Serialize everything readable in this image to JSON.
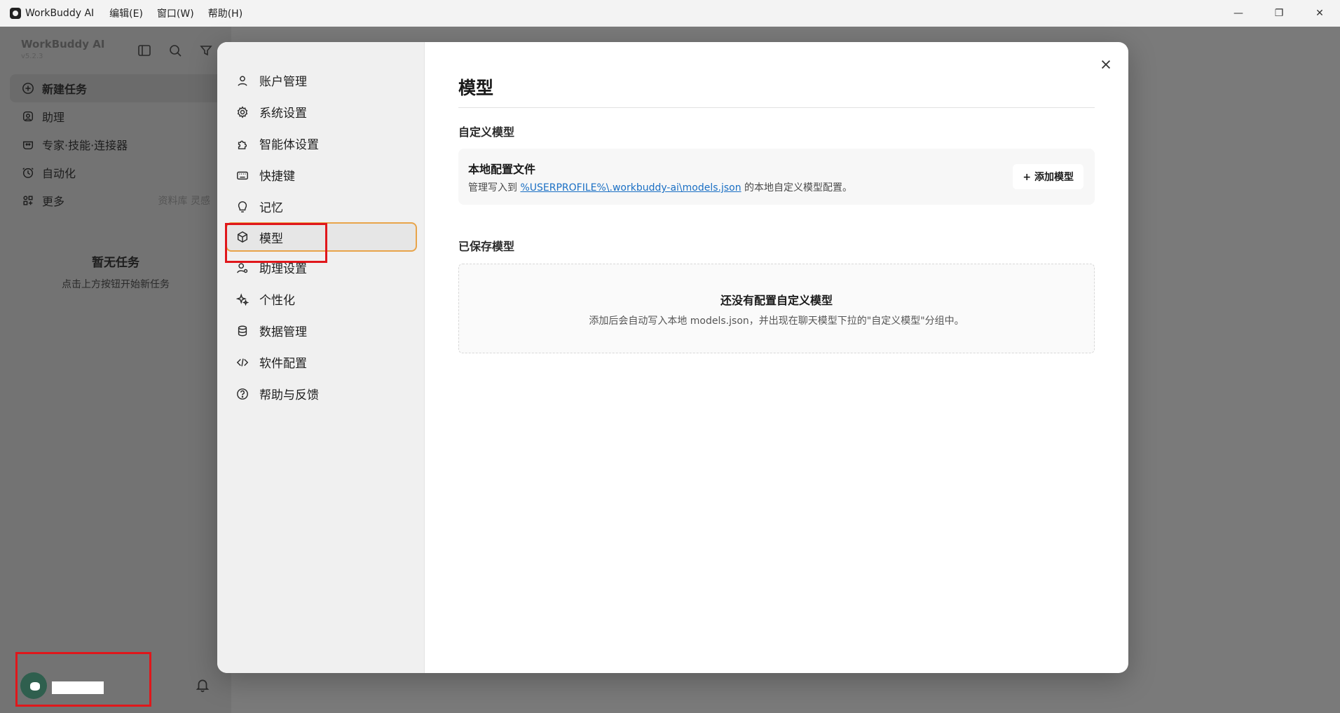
{
  "titlebar": {
    "app_name": "WorkBuddy AI",
    "menus": [
      "编辑(E)",
      "窗口(W)",
      "帮助(H)"
    ],
    "minimize": "—",
    "maximize": "❐",
    "close": "✕"
  },
  "sidebar": {
    "title": "WorkBuddy AI",
    "version": "v5.2.3",
    "items": [
      {
        "label": "新建任务",
        "icon": "plus-chat-icon"
      },
      {
        "label": "助理",
        "icon": "assistant-icon"
      },
      {
        "label": "专家·技能·连接器",
        "icon": "expert-icon"
      },
      {
        "label": "自动化",
        "icon": "clock-icon"
      },
      {
        "label": "更多",
        "icon": "grid-icon",
        "hint": "资料库 灵感"
      }
    ],
    "empty_title": "暂无任务",
    "empty_subtitle": "点击上方按钮开始新任务"
  },
  "settings_nav": {
    "items": [
      {
        "label": "账户管理",
        "icon": "user-icon"
      },
      {
        "label": "系统设置",
        "icon": "gear-icon"
      },
      {
        "label": "智能体设置",
        "icon": "puzzle-icon"
      },
      {
        "label": "快捷键",
        "icon": "keyboard-icon"
      },
      {
        "label": "记忆",
        "icon": "memory-icon"
      },
      {
        "label": "模型",
        "icon": "cube-icon"
      },
      {
        "label": "助理设置",
        "icon": "user-gear-icon"
      },
      {
        "label": "个性化",
        "icon": "sparkle-icon"
      },
      {
        "label": "数据管理",
        "icon": "database-icon"
      },
      {
        "label": "软件配置",
        "icon": "code-icon"
      },
      {
        "label": "帮助与反馈",
        "icon": "help-icon"
      }
    ],
    "active_index": 5
  },
  "main": {
    "title": "模型",
    "custom_section_label": "自定义模型",
    "local_config": {
      "title": "本地配置文件",
      "desc_prefix": "管理写入到 ",
      "desc_path": "%USERPROFILE%\\.workbuddy-ai\\models.json",
      "desc_suffix": " 的本地自定义模型配置。",
      "add_button": "+ 添加模型"
    },
    "saved_section_label": "已保存模型",
    "empty": {
      "title": "还没有配置自定义模型",
      "subtitle": "添加后会自动写入本地 models.json，并出现在聊天模型下拉的\"自定义模型\"分组中。"
    }
  },
  "colors": {
    "highlight_red": "#e0171b",
    "active_border": "#e8a44a",
    "link": "#1a6fc4"
  }
}
